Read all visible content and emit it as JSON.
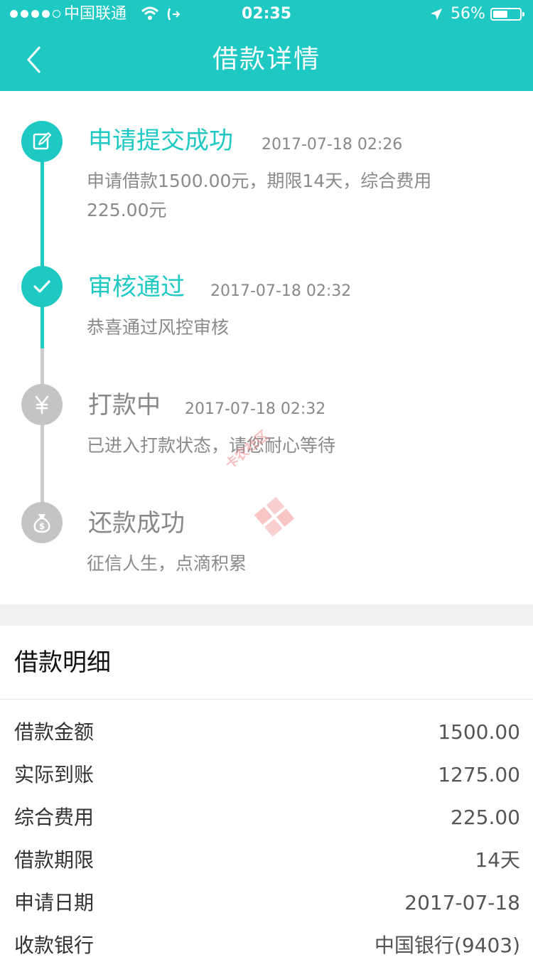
{
  "status_bar": {
    "carrier": "中国联通",
    "time": "02:35",
    "battery": "56%",
    "battery_level": 0.56
  },
  "nav": {
    "title": "借款详情"
  },
  "timeline": [
    {
      "title": "申请提交成功",
      "time": "2017-07-18 02:26",
      "desc": "申请借款1500.00元，期限14天，综合费用225.00元",
      "state": "done",
      "icon": "edit-icon"
    },
    {
      "title": "审核通过",
      "time": "2017-07-18 02:32",
      "desc": "恭喜通过风控审核",
      "state": "done",
      "icon": "check-icon"
    },
    {
      "title": "打款中",
      "time": "2017-07-18 02:32",
      "desc": "已进入打款状态，请您耐心等待",
      "state": "pending",
      "icon": "yen-icon"
    },
    {
      "title": "还款成功",
      "time": "",
      "desc": "征信人生，点滴积累",
      "state": "pending",
      "icon": "money-bag-icon"
    }
  ],
  "watermark": "卡农社区",
  "details": {
    "title": "借款明细",
    "rows": [
      {
        "label": "借款金额",
        "value": "1500.00"
      },
      {
        "label": "实际到账",
        "value": "1275.00"
      },
      {
        "label": "综合费用",
        "value": "225.00"
      },
      {
        "label": "借款期限",
        "value": "14天"
      },
      {
        "label": "申请日期",
        "value": "2017-07-18"
      },
      {
        "label": "收款银行",
        "value": "中国银行(9403)"
      }
    ]
  },
  "colors": {
    "accent": "#1ec9c4",
    "inactive": "#c4c4c4",
    "section_gap": "#f0f0f0"
  }
}
